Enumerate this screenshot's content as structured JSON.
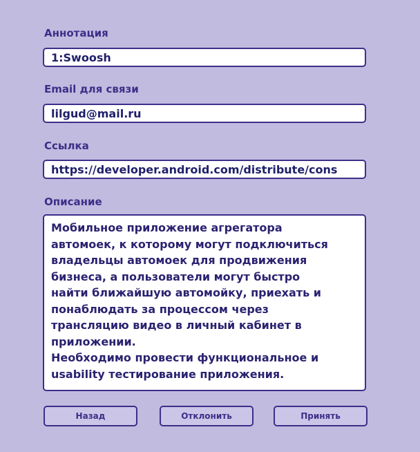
{
  "colors": {
    "background": "#c2bbe0",
    "accent": "#3b2f87",
    "field_background": "#ffffff",
    "button_background": "#cbc5e8"
  },
  "form": {
    "annotation": {
      "label": "Аннотация",
      "value": "1:Swoosh"
    },
    "email": {
      "label": "Email для связи",
      "value": "lilgud@mail.ru"
    },
    "link": {
      "label": "Ссылка",
      "value": "https://developer.android.com/distribute/cons"
    },
    "description": {
      "label": "Описание",
      "value": "Мобильное приложение агрегатора\nавтомоек, к которому могут подключиться\nвладельцы автомоек для продвижения\nбизнеса, а пользователи могут быстро\nнайти ближайшую автомойку, приехать и\nпонаблюдать за процессом через\nтрансляцию видео в личный кабинет в\nприложении.\nНеобходимо провести функциональное и\nusability тестирование приложения."
    }
  },
  "buttons": {
    "back": "Назад",
    "reject": "Отклонить",
    "accept": "Принять"
  }
}
